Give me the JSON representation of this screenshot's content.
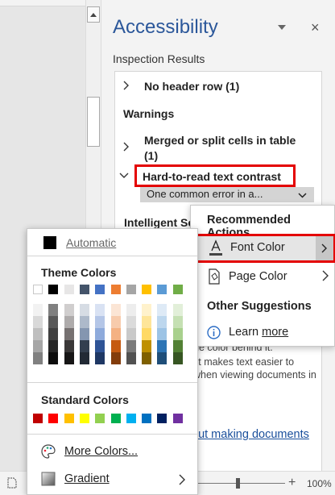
{
  "pane": {
    "title": "Accessibility",
    "inspection_label": "Inspection Results",
    "close_glyph": "×"
  },
  "results": {
    "no_header_row": "No header row (1)",
    "warnings": "Warnings",
    "merged_line1": "Merged or split cells in table",
    "merged_line2": "(1)",
    "hard_to_read": "Hard-to-read text contrast",
    "one_error": "One common error in a...",
    "intelligent_partial": "Intelligent Se",
    "faded_line1": "he color behind it.",
    "faded_line2": "st makes text easier to",
    "faded_line3": "when viewing documents in",
    "learn_more_partial": "out making documents"
  },
  "recommended": {
    "title": "Recommended Actions",
    "font_color": "Font Color",
    "page_color": "Page Color",
    "other_suggestions": "Other Suggestions",
    "learn_prefix": "Learn ",
    "learn_link": "more"
  },
  "picker": {
    "automatic": "Automatic",
    "theme_colors_header": "Theme Colors",
    "standard_colors_header": "Standard Colors",
    "more_colors": "More Colors...",
    "gradient": "Gradient",
    "theme_top_row": [
      "#FFFFFF",
      "#000000",
      "#E7E6E6",
      "#44546A",
      "#4472C4",
      "#ED7D31",
      "#A5A5A5",
      "#FFC000",
      "#5B9BD5",
      "#70AD47"
    ],
    "theme_shades": [
      [
        "#F2F2F2",
        "#D9D9D9",
        "#BFBFBF",
        "#A6A6A6",
        "#808080"
      ],
      [
        "#808080",
        "#595959",
        "#404040",
        "#262626",
        "#0D0D0D"
      ],
      [
        "#D0CECE",
        "#AEABAB",
        "#767171",
        "#3A3838",
        "#171616"
      ],
      [
        "#D6DCE4",
        "#ADB9CA",
        "#8496B0",
        "#333F4F",
        "#222A35"
      ],
      [
        "#D9E2F3",
        "#B4C6E7",
        "#8EAADB",
        "#2F5496",
        "#1F3864"
      ],
      [
        "#FBE5D5",
        "#F7CBAC",
        "#F4B183",
        "#C55A11",
        "#833C0B"
      ],
      [
        "#EDEDED",
        "#DBDBDB",
        "#C9C9C9",
        "#7B7B7B",
        "#525252"
      ],
      [
        "#FFF2CC",
        "#FEE599",
        "#FFD965",
        "#BF9000",
        "#7F6000"
      ],
      [
        "#DEEAF6",
        "#BDD7EE",
        "#9CC3E5",
        "#2E75B5",
        "#1F4E79"
      ],
      [
        "#E2EFD9",
        "#C5E0B3",
        "#A8D08D",
        "#538135",
        "#375623"
      ]
    ],
    "standard": [
      "#C00000",
      "#FF0000",
      "#FFC000",
      "#FFFF00",
      "#92D050",
      "#00B050",
      "#00B0F0",
      "#0070C0",
      "#002060",
      "#7030A0"
    ]
  },
  "status": {
    "zoom": "100%",
    "zoom_plus": "+"
  },
  "colors": {
    "title_blue": "#2B579A",
    "highlight_red": "#E40000",
    "link_blue": "#1A4F9C"
  }
}
